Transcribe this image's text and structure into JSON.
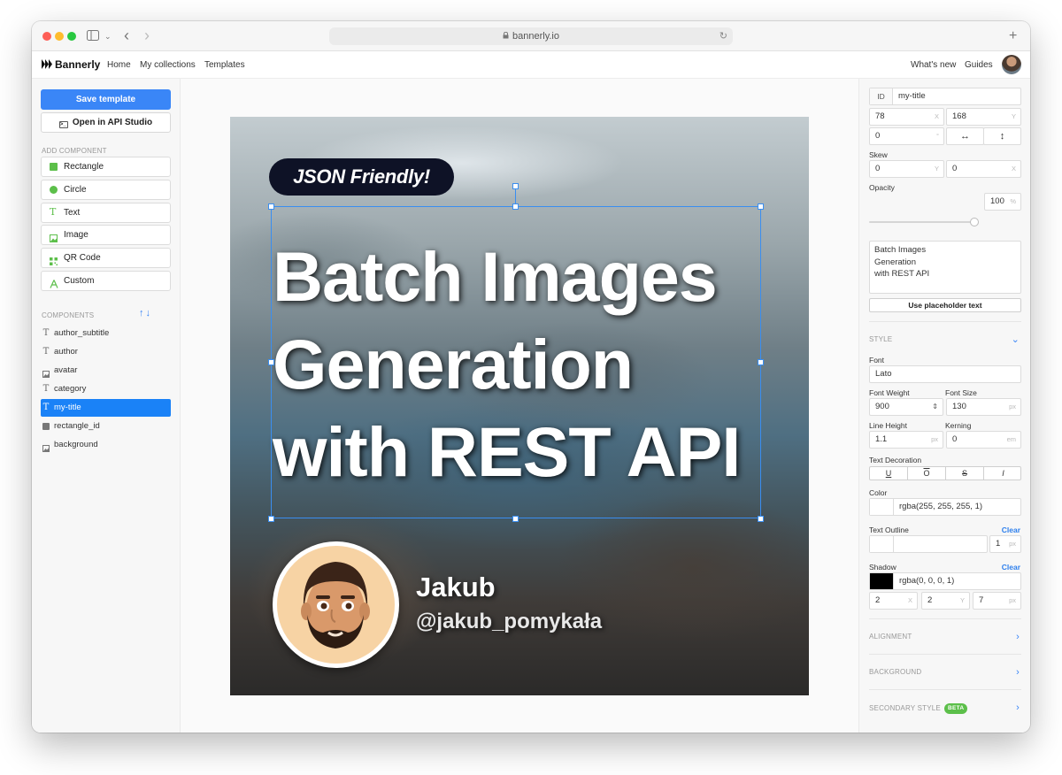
{
  "browser": {
    "url": "bannerly.io",
    "new_tab": "+",
    "back": "‹",
    "forward": "›",
    "sidebar_toggle_icon": "sidebar-icon"
  },
  "app": {
    "brand": "Bannerly",
    "nav": {
      "home": "Home",
      "collections": "My collections",
      "templates": "Templates"
    },
    "right_nav": {
      "whats_new": "What's new",
      "guides": "Guides"
    }
  },
  "left": {
    "save_label": "Save template",
    "api_label": "Open in API Studio",
    "add_component_label": "ADD COMPONENT",
    "add": [
      "Rectangle",
      "Circle",
      "Text",
      "Image",
      "QR Code",
      "Custom"
    ],
    "components_label": "COMPONENTS",
    "sort_arrows": "↑↓",
    "components": [
      {
        "name": "author_subtitle",
        "icon": "text-icon"
      },
      {
        "name": "author",
        "icon": "text-icon"
      },
      {
        "name": "avatar",
        "icon": "image-icon"
      },
      {
        "name": "category",
        "icon": "text-icon"
      },
      {
        "name": "my-title",
        "icon": "text-icon",
        "selected": true
      },
      {
        "name": "rectangle_id",
        "icon": "rectangle-icon"
      },
      {
        "name": "background",
        "icon": "image-icon"
      }
    ]
  },
  "canvas": {
    "category": "JSON Friendly!",
    "title_lines": [
      "Batch Images",
      "Generation",
      "with REST API"
    ],
    "author": "Jakub",
    "author_subtitle": "@jakub_pomykała"
  },
  "props": {
    "id_tag": "ID",
    "id_value": "my-title",
    "x": "78",
    "x_unit": "X",
    "y": "168",
    "y_unit": "Y",
    "rotation": "0",
    "rotation_unit": "°",
    "flip_h": "↔",
    "flip_v": "↕",
    "skew_label": "Skew",
    "skew_y": "0",
    "skew_y_unit": "Y",
    "skew_x": "0",
    "skew_x_unit": "X",
    "opacity_label": "Opacity",
    "opacity": "100",
    "opacity_unit": "%",
    "opacity_fraction": 1.0,
    "text_lines": [
      "Batch Images",
      "Generation",
      "with REST API"
    ],
    "placeholder_btn": "Use placeholder text",
    "style_label": "STYLE",
    "font_label": "Font",
    "font": "Lato",
    "font_weight_label": "Font Weight",
    "font_weight": "900",
    "font_size_label": "Font Size",
    "font_size": "130",
    "font_size_unit": "px",
    "line_height_label": "Line Height",
    "line_height": "1.1",
    "line_height_unit": "px",
    "kerning_label": "Kerning",
    "kerning": "0",
    "kerning_unit": "em",
    "decoration_label": "Text Decoration",
    "decorations": [
      "U",
      "O",
      "S",
      "I"
    ],
    "color_label": "Color",
    "color": "rgba(255, 255, 255, 1)",
    "outline_label": "Text Outline",
    "clear": "Clear",
    "outline_width": "1",
    "outline_unit": "px",
    "shadow_label": "Shadow",
    "shadow_color": "rgba(0, 0, 0, 1)",
    "shadow_x": "2",
    "shadow_x_unit": "X",
    "shadow_y": "2",
    "shadow_y_unit": "Y",
    "shadow_blur": "7",
    "shadow_blur_unit": "px",
    "alignment_label": "ALIGNMENT",
    "background_label": "BACKGROUND",
    "secondary_label": "SECONDARY STYLE",
    "beta": "BETA"
  },
  "colors": {
    "accent": "#3a86f7",
    "selected": "#1a82f7",
    "pill_bg": "#0e1226",
    "swatch_white": "#ffffff",
    "swatch_black": "#000000",
    "shape_green": "#5cbf4a"
  }
}
